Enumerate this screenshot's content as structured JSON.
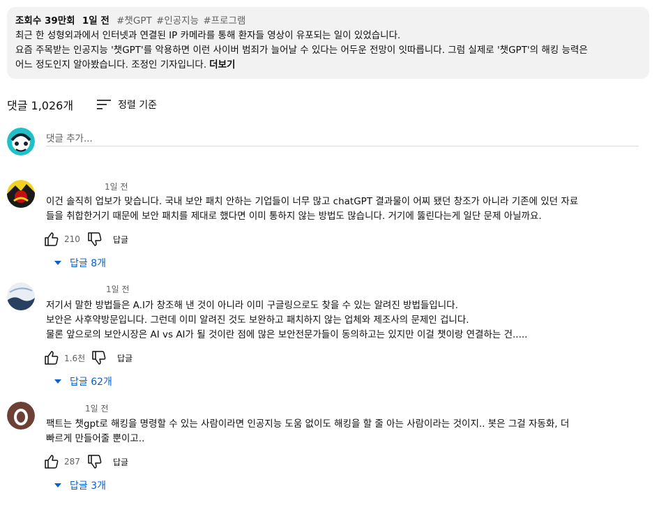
{
  "description": {
    "views": "조회수 39만회",
    "date": "1일 전",
    "tags": [
      "#챗GPT",
      "#인공지능",
      "#프로그램"
    ],
    "lines": [
      "최근 한 성형외과에서 인터넷과 연결된 IP 카메라를 통해 환자들 영상이 유포되는 일이 있었습니다.",
      "요즘 주목받는 인공지능 '챗GPT'를 악용하면 이런 사이버 범죄가 늘어날 수 있다는 어두운 전망이 잇따릅니다. 그럼 실제로 '챗GPT'의 해킹 능력은",
      "어느 정도인지 알아봤습니다. 조정인 기자입니다."
    ],
    "more_label": "더보기"
  },
  "comments_header": {
    "count_label": "댓글 1,026개",
    "sort_label": "정렬 기준"
  },
  "add_comment": {
    "placeholder": "댓글 추가..."
  },
  "comments": [
    {
      "author": "",
      "time": "1일 전",
      "text": [
        "이건 솔직히 업보가 맞습니다. 국내 보안 패치 안하는 기업들이 너무 많고 chatGPT 결과물이 어찌 됐던 창조가 아니라 기존에 있던 자료",
        "들을 취합한거기 때문에 보안 패치를 제대로 했다면 이미 통하지 않는 방법도 많습니다. 거기에 뚫린다는게 일단  문제 아닐까요."
      ],
      "likes": "210",
      "reply_label": "답글",
      "replies_label": "답글 8개"
    },
    {
      "author": "",
      "time": "1일 전",
      "text": [
        "저기서 말한 방법들은 A.I가 창조해 낸 것이 아니라 이미 구글링으로도 찾을 수 있는 알려진 방법들입니다.",
        "보안은 사후약방문입니다. 그런데 이미 알려진 것도 보완하고 패치하지 않는 업체와 제조사의 문제인 겁니다.",
        "물론 앞으로의 보안시장은 AI vs AI가 될 것이란 점에 많은 보안전문가들이 동의하고는 있지만 이걸 챗이랑 연결하는 건....."
      ],
      "likes": "1.6천",
      "reply_label": "답글",
      "replies_label": "답글 62개"
    },
    {
      "author": "",
      "time": "1일 전",
      "text": [
        "팩트는 챗gpt로 해킹을 명령할 수 있는 사람이라면 인공지능 도움 없이도 해킹을 할 줄 아는 사람이라는 것이지.. 봇은 그걸 자동화, 더",
        "빠르게 만들어줄 뿐이고.."
      ],
      "likes": "287",
      "reply_label": "답글",
      "replies_label": "답글 3개"
    }
  ],
  "colors": {
    "link_blue": "#065fd4",
    "secondary_text": "#606060",
    "description_bg": "#f2f2f2"
  }
}
